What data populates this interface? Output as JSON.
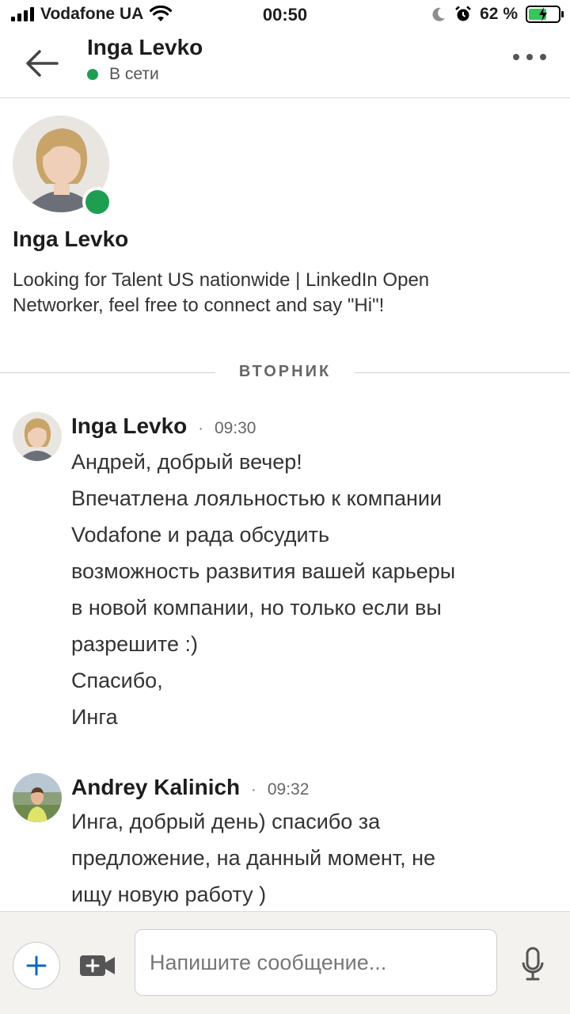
{
  "status_bar": {
    "carrier": "Vodafone UA",
    "time": "00:50",
    "battery_text": "62 %",
    "battery_level": 0.62
  },
  "header": {
    "title": "Inga Levko",
    "presence": "В сети",
    "back_icon": "arrow-left-icon",
    "more_icon": "more-dots-icon"
  },
  "profile": {
    "name": "Inga Levko",
    "headline": "Looking for Talent US nationwide | LinkedIn Open Networker, feel free to connect and say \"Hi\"!"
  },
  "day_divider": "ВТОРНИК",
  "messages": [
    {
      "sender": "Inga Levko",
      "separator": "·",
      "time": "09:30",
      "lines": [
        "Андрей, добрый вечер!",
        "Впечатлена лояльностью к компании",
        "Vodafone и рада обсудить",
        "возможность развития вашей карьеры",
        "в новой компании, но только если вы",
        "разрешите :)",
        "Спасибо,",
        "Инга"
      ]
    },
    {
      "sender": "Andrey Kalinich",
      "separator": "·",
      "time": "09:32",
      "lines": [
        "Инга, добрый день) спасибо за",
        "предложение, на данный момент, не",
        "ищу новую работу )"
      ]
    }
  ],
  "composer": {
    "placeholder": "Напишите сообщение...",
    "value": ""
  },
  "colors": {
    "online_green": "#1f9e52",
    "accent_blue": "#0a66c2",
    "composer_bg": "#f3f2ef"
  }
}
